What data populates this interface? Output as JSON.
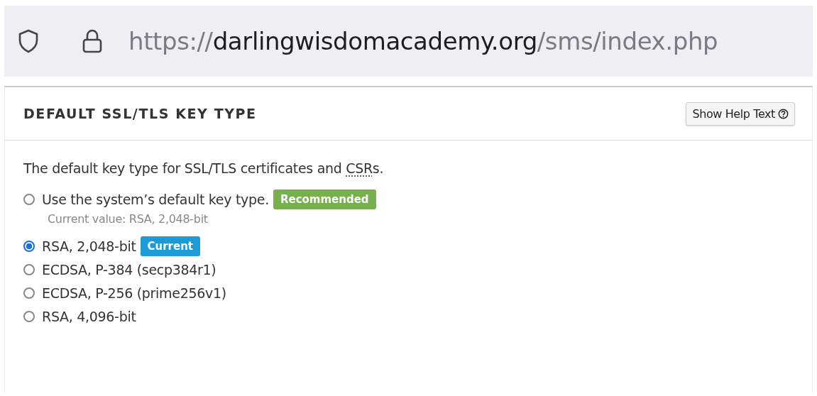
{
  "address_bar": {
    "scheme": "https://",
    "domain": "darlingwisdomacademy.org",
    "path": "/sms/index.php"
  },
  "section": {
    "title": "DEFAULT SSL/TLS KEY TYPE",
    "help_button": "Show Help Text"
  },
  "description": {
    "before": "The default key type for SSL/TLS certificates and ",
    "abbr": "CSR",
    "after": "s."
  },
  "options": [
    {
      "label": "Use the system’s default key type.",
      "selected": false,
      "badge": {
        "text": "Recommended",
        "color": "#78b04e"
      },
      "note": "Current value: RSA, 2,048-bit"
    },
    {
      "label": "RSA, 2,048-bit",
      "selected": true,
      "badge": {
        "text": "Current",
        "color": "#1c9ad6"
      }
    },
    {
      "label": "ECDSA, P-384 (secp384r1)",
      "selected": false
    },
    {
      "label": "ECDSA, P-256 (prime256v1)",
      "selected": false
    },
    {
      "label": "RSA, 4,096-bit",
      "selected": false
    }
  ]
}
